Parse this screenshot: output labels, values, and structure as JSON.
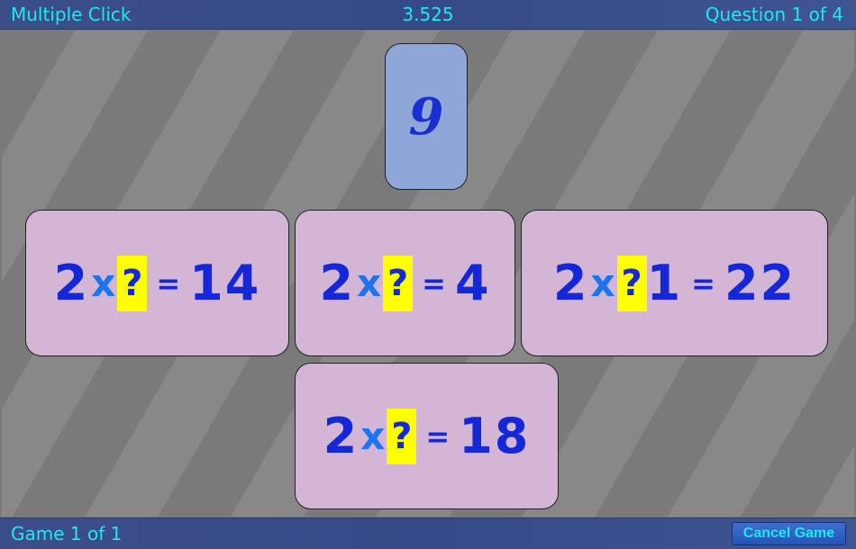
{
  "header": {
    "title": "Multiple Click",
    "score": "3.525",
    "question": "Question 1 of 4"
  },
  "footer": {
    "game": "Game 1 of 1",
    "cancel_label": "Cancel Game"
  },
  "target": {
    "value": "9"
  },
  "cards": [
    {
      "left": "2",
      "op": "x",
      "q": "?",
      "suffix": "",
      "eq": "=",
      "result": "14"
    },
    {
      "left": "2",
      "op": "x",
      "q": "?",
      "suffix": "",
      "eq": "=",
      "result": "4"
    },
    {
      "left": "2",
      "op": "x",
      "q": "?",
      "suffix": "1",
      "eq": "=",
      "result": "22"
    },
    {
      "left": "2",
      "op": "x",
      "q": "?",
      "suffix": "",
      "eq": "=",
      "result": "18"
    }
  ]
}
